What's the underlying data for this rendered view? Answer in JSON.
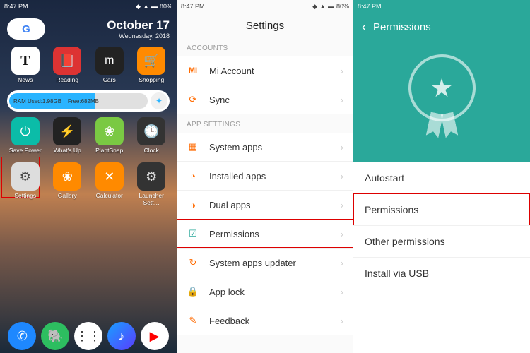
{
  "status": {
    "time": "8:47 PM",
    "battery": "80%"
  },
  "home": {
    "date_main": "October 17",
    "date_sub": "Wednesday, 2018",
    "ram_used_label": "RAM Used:1.98GB",
    "ram_free_label": "Free:682MB",
    "row1": [
      {
        "label": "News"
      },
      {
        "label": "Reading"
      },
      {
        "label": "Cars"
      },
      {
        "label": "Shopping"
      }
    ],
    "row2": [
      {
        "label": "Save Power"
      },
      {
        "label": "What's Up"
      },
      {
        "label": "PlantSnap"
      },
      {
        "label": "Clock"
      }
    ],
    "row3": [
      {
        "label": "Settings"
      },
      {
        "label": "Gallery"
      },
      {
        "label": "Calculator"
      },
      {
        "label": "Launcher Sett…"
      }
    ]
  },
  "settings": {
    "title": "Settings",
    "section_accounts": "ACCOUNTS",
    "section_app": "APP SETTINGS",
    "accounts": [
      {
        "label": "Mi Account"
      },
      {
        "label": "Sync"
      }
    ],
    "app_settings": [
      {
        "label": "System apps"
      },
      {
        "label": "Installed apps"
      },
      {
        "label": "Dual apps"
      },
      {
        "label": "Permissions",
        "highlight": true
      },
      {
        "label": "System apps updater"
      },
      {
        "label": "App lock"
      },
      {
        "label": "Feedback"
      }
    ]
  },
  "permissions": {
    "title": "Permissions",
    "items": [
      {
        "label": "Autostart"
      },
      {
        "label": "Permissions",
        "highlight": true
      },
      {
        "label": "Other permissions"
      },
      {
        "label": "Install via USB"
      }
    ]
  }
}
